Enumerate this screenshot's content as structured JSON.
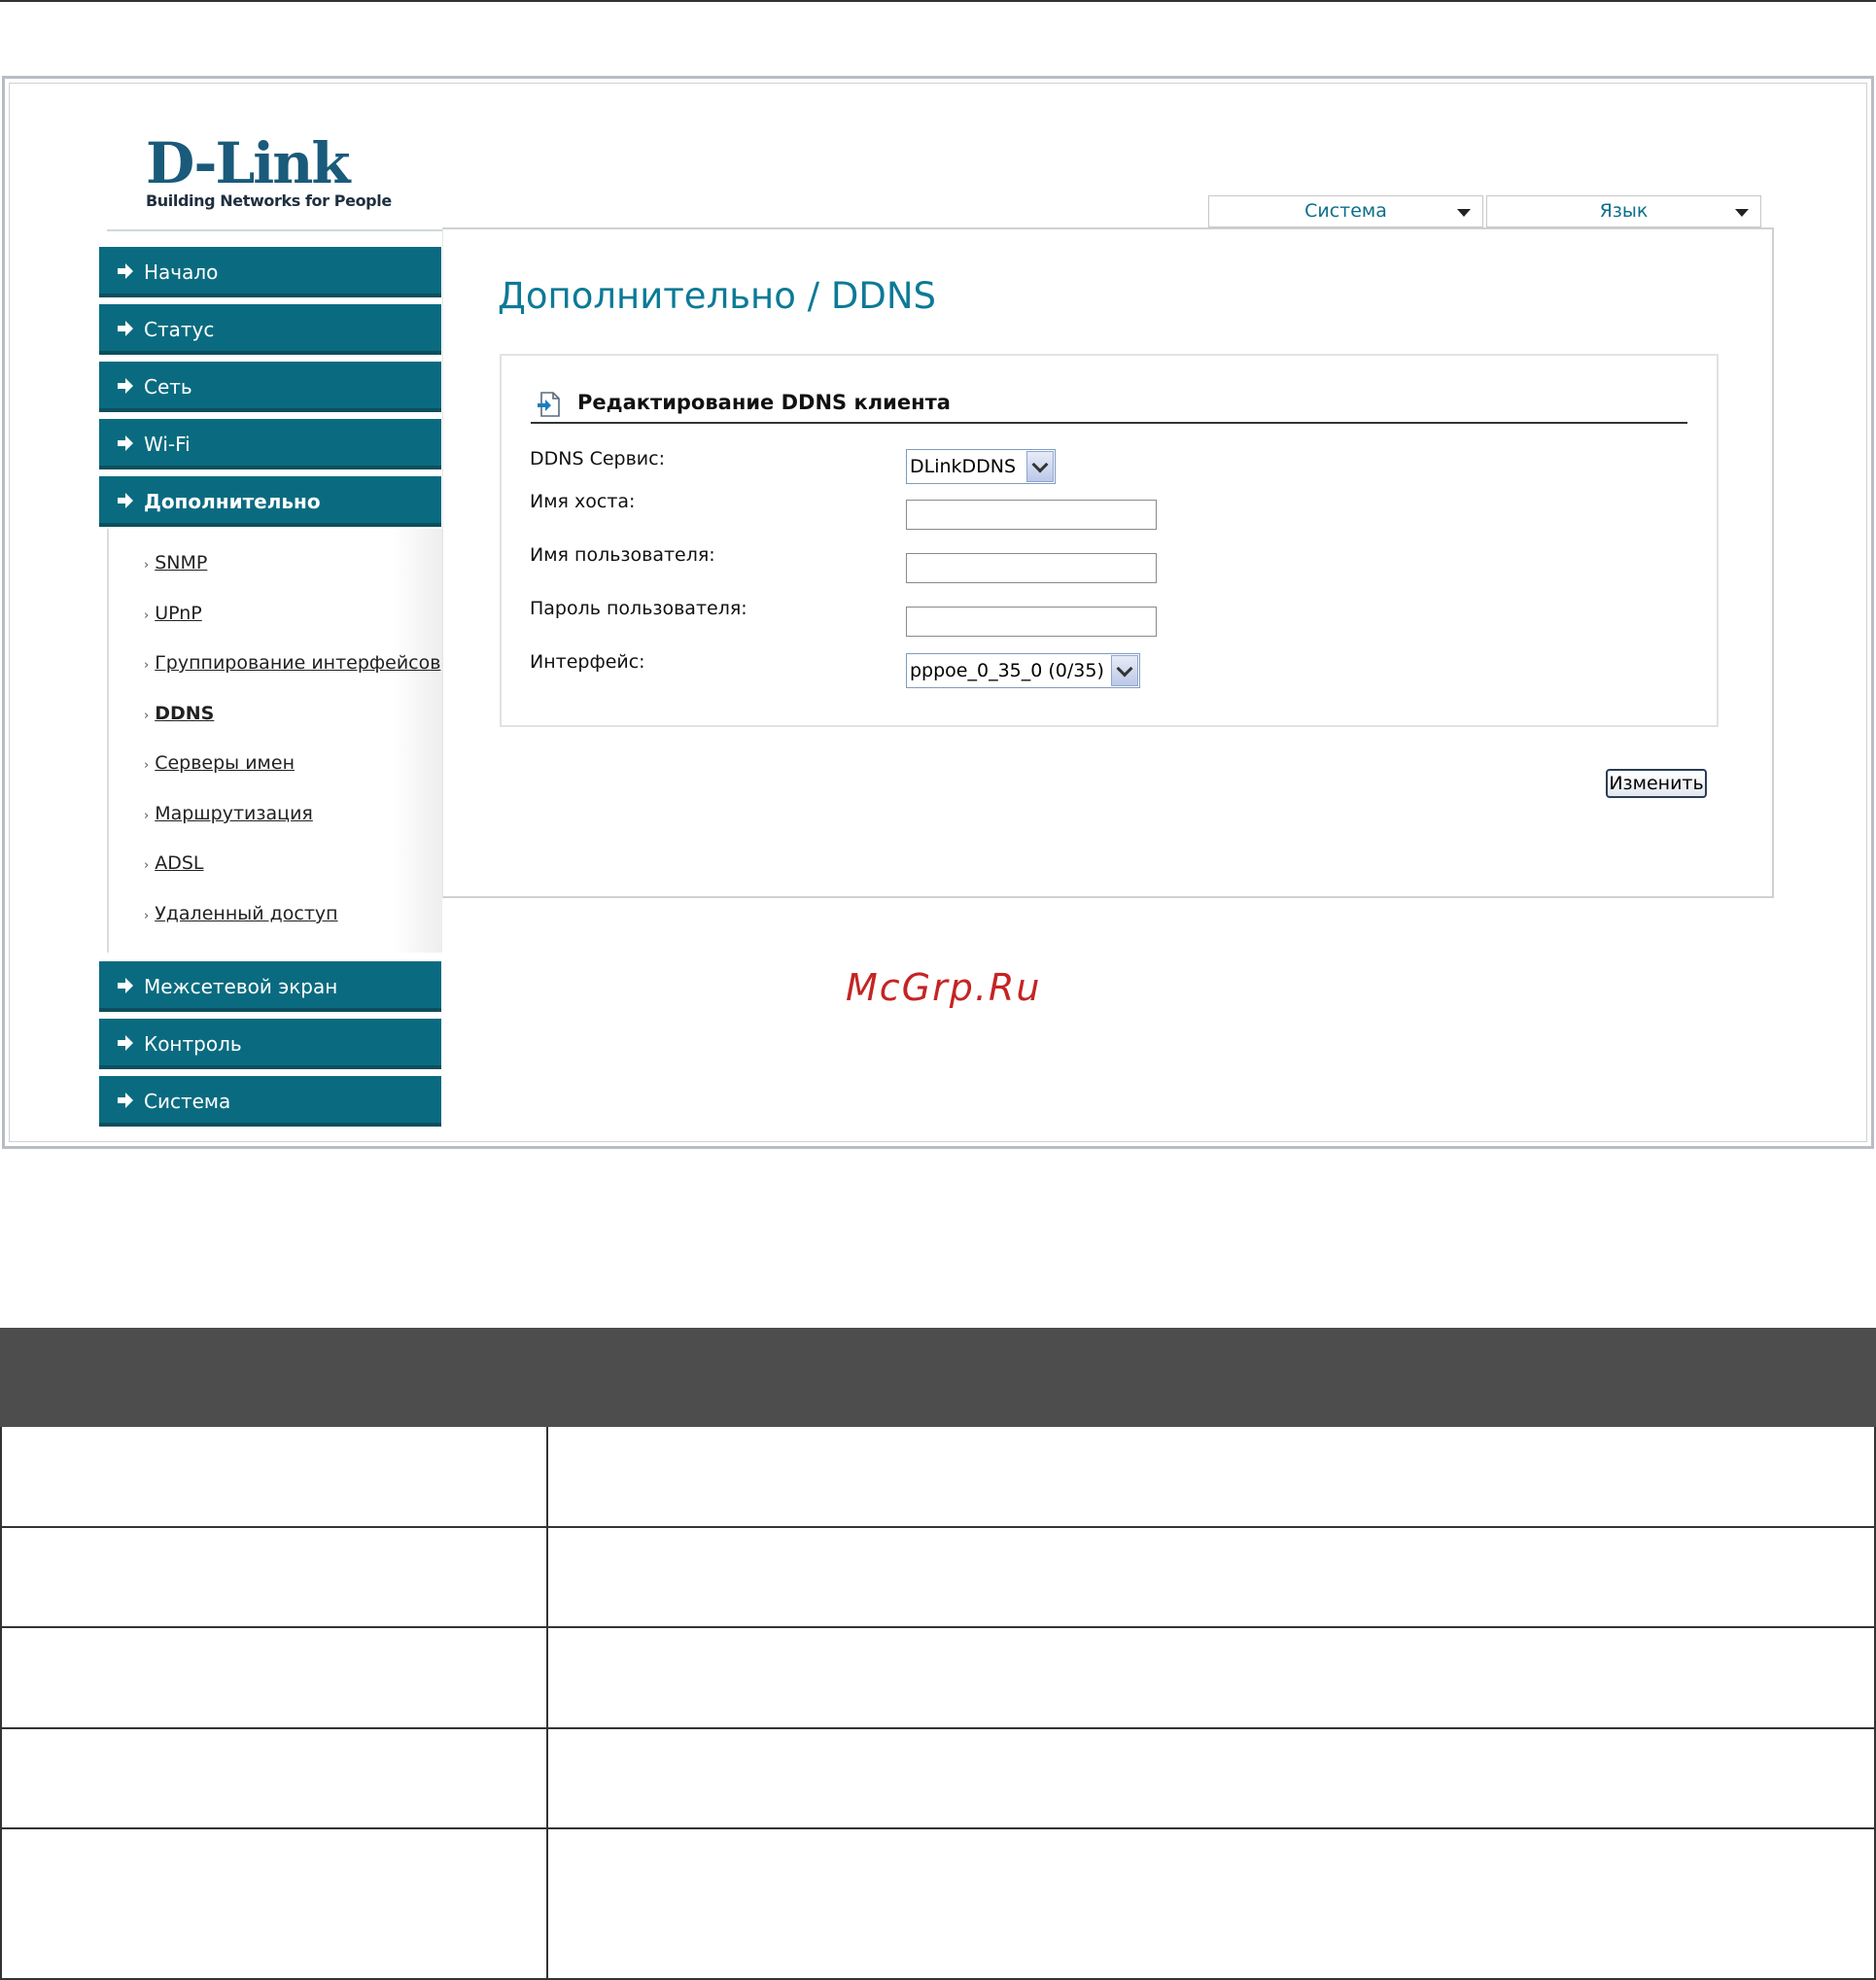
{
  "logo": {
    "brand": "D-Link",
    "tagline": "Building Networks for People"
  },
  "top_menu": {
    "system": "Система",
    "language": "Язык"
  },
  "nav": {
    "items": [
      {
        "label": "Начало"
      },
      {
        "label": "Статус"
      },
      {
        "label": "Сеть"
      },
      {
        "label": "Wi-Fi"
      },
      {
        "label": "Дополнительно"
      },
      {
        "label": "Межсетевой экран"
      },
      {
        "label": "Контроль"
      },
      {
        "label": "Система"
      }
    ],
    "sub_items": [
      {
        "label": "SNMP"
      },
      {
        "label": "UPnP"
      },
      {
        "label": "Группирование интерфейсов"
      },
      {
        "label": "DDNS"
      },
      {
        "label": "Серверы имен"
      },
      {
        "label": "Маршрутизация"
      },
      {
        "label": "ADSL"
      },
      {
        "label": "Удаленный доступ"
      }
    ],
    "active": "Дополнительно",
    "active_sub": "DDNS"
  },
  "page": {
    "title": "Дополнительно /  DDNS",
    "section_title": "Редактирование DDNS клиента",
    "fields": {
      "service_label": "DDNS Сервис:",
      "service_value": "DLinkDDNS",
      "host_label": "Имя хоста:",
      "host_value": "",
      "user_label": "Имя пользователя:",
      "user_value": "",
      "password_label": "Пароль пользователя:",
      "password_value": "",
      "interface_label": "Интерфейс:",
      "interface_value": "pppoe_0_35_0 (0/35)"
    },
    "change_button": "Изменить"
  },
  "watermark": "McGrp.Ru",
  "colors": {
    "nav": "#0a6b80",
    "title": "#0b7a96",
    "table_header": "#4d4d4d"
  }
}
